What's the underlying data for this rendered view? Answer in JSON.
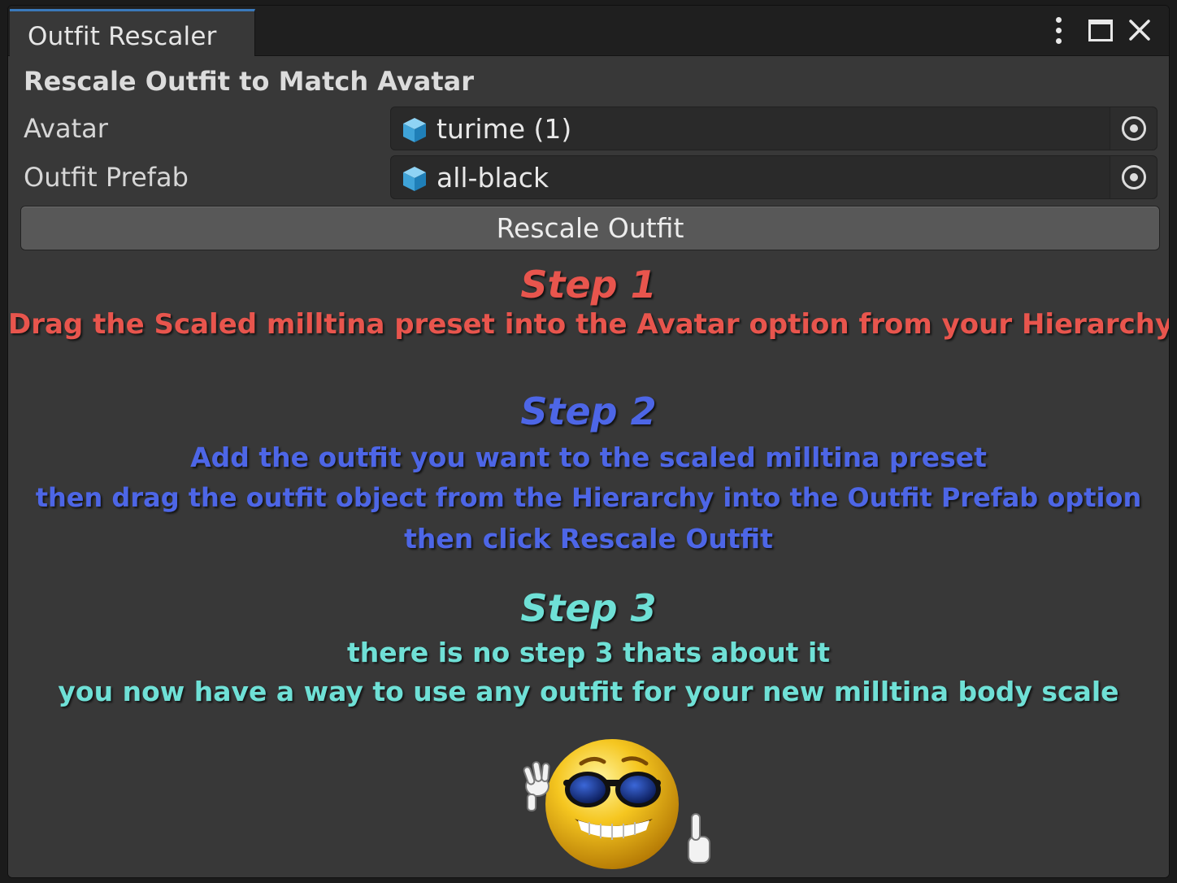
{
  "window": {
    "tab_title": "Outfit Rescaler"
  },
  "section_header": "Rescale Outfit to Match Avatar",
  "fields": {
    "avatar": {
      "label": "Avatar",
      "value": "turime (1)",
      "icon": "prefab-cube-icon"
    },
    "outfit": {
      "label": "Outfit Prefab",
      "value": "all-black",
      "icon": "prefab-cube-icon"
    }
  },
  "rescale_button": "Rescale Outfit",
  "steps": {
    "step1": {
      "title": "Step 1",
      "lines": [
        "Drag the Scaled milltina preset into the Avatar option from your Hierarchy"
      ],
      "color": "#e8554d"
    },
    "step2": {
      "title": "Step 2",
      "lines": [
        "Add the outfit you want to the scaled milltina preset",
        "then drag the outfit object from the Hierarchy into the Outfit Prefab option",
        "then click Rescale Outfit"
      ],
      "color": "#4d66e6"
    },
    "step3": {
      "title": "Step 3",
      "lines": [
        "there is no step 3 thats about it",
        "you now have a way to use any outfit for your new milltina body scale"
      ],
      "color": "#6fe0d6"
    }
  },
  "colors": {
    "accent": "#3a79bb",
    "background": "#383838",
    "field_background": "#2a2a2a"
  },
  "image": {
    "icon": "cool-sunglasses-thumbs-up-emoji"
  }
}
